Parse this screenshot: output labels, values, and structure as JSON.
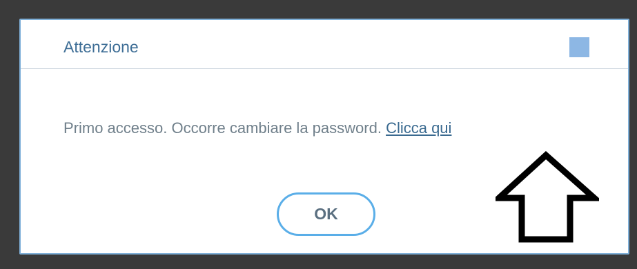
{
  "dialog": {
    "title": "Attenzione",
    "message": "Primo accesso. Occorre cambiare la password.",
    "link_label": "Clicca qui",
    "ok_label": "OK"
  },
  "annotation": {
    "icon": "up-arrow-icon"
  },
  "colors": {
    "title": "#3e6e96",
    "border": "#7fb0d9",
    "close_square": "#8db7e4",
    "ok_border": "#5aaee8",
    "background": "#3a3a3a"
  }
}
